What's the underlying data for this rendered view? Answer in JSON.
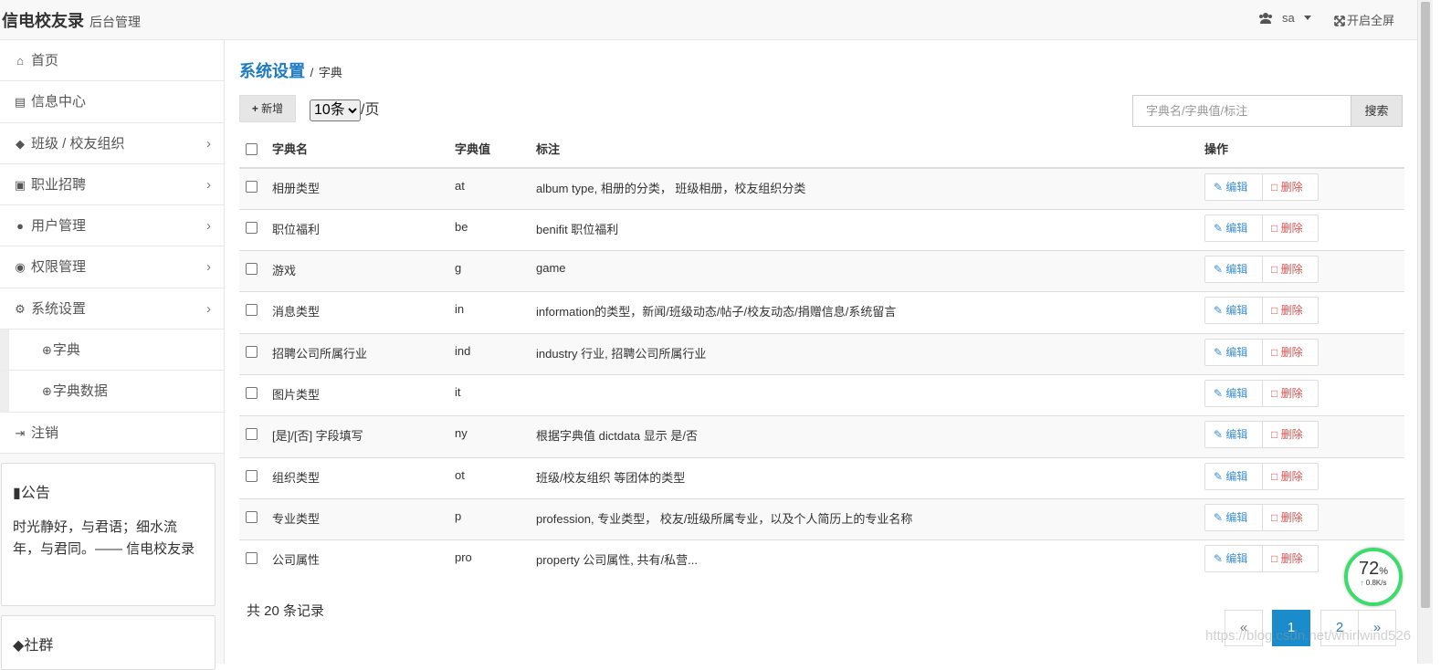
{
  "header": {
    "brand": "信电校友录",
    "brand_sub": "后台管理",
    "user_icon": "users-icon",
    "user_name": "sa",
    "fullscreen_icon": "expand-icon",
    "fullscreen_label": "开启全屏"
  },
  "sidebar": {
    "items": [
      {
        "label": "首页",
        "icon": "home-icon"
      },
      {
        "label": "信息中心",
        "icon": "newspaper-icon"
      },
      {
        "label": "班级 / 校友组织",
        "icon": "graduation-cap-icon"
      },
      {
        "label": "职业招聘",
        "icon": "briefcase-icon"
      },
      {
        "label": "用户管理",
        "icon": "users-icon"
      },
      {
        "label": "权限管理",
        "icon": "eye-icon"
      },
      {
        "label": "系统设置",
        "icon": "cogs-icon"
      }
    ],
    "subitems": [
      {
        "label": "字典",
        "icon": "search-plus-icon"
      },
      {
        "label": "字典数据",
        "icon": "search-plus-icon"
      }
    ],
    "logout": {
      "label": "注销",
      "icon": "sign-out-icon"
    },
    "notice": {
      "title": "公告",
      "icon": "bookmark-icon",
      "body": "时光静好，与君语；细水流年，与君同。—— 信电校友录"
    },
    "community": {
      "title": "社群",
      "icon": "tag-icon"
    }
  },
  "main": {
    "breadcrumb": {
      "section": "系统设置",
      "separator": " / ",
      "page": "字典"
    },
    "add_button": "新增",
    "per_page": {
      "selected": "10条",
      "suffix": "/页"
    },
    "search": {
      "placeholder": "字典名/字典值/标注",
      "button": "搜索"
    },
    "table": {
      "columns": [
        "字典名",
        "字典值",
        "标注",
        "操作"
      ],
      "rows": [
        {
          "name": "相册类型",
          "value": "at",
          "note": "album type, 相册的分类， 班级相册，校友组织分类"
        },
        {
          "name": "职位福利",
          "value": "be",
          "note": "benifit 职位福利"
        },
        {
          "name": "游戏",
          "value": "g",
          "note": "game"
        },
        {
          "name": "消息类型",
          "value": "in",
          "note": "information的类型，新闻/班级动态/帖子/校友动态/捐赠信息/系统留言"
        },
        {
          "name": "招聘公司所属行业",
          "value": "ind",
          "note": "industry 行业, 招聘公司所属行业"
        },
        {
          "name": "图片类型",
          "value": "it",
          "note": ""
        },
        {
          "name": "[是]/[否] 字段填写",
          "value": "ny",
          "note": "根据字典值 dictdata 显示 是/否"
        },
        {
          "name": "组织类型",
          "value": "ot",
          "note": "班级/校友组织 等团体的类型"
        },
        {
          "name": "专业类型",
          "value": "p",
          "note": "profession, 专业类型， 校友/班级所属专业，以及个人简历上的专业名称"
        },
        {
          "name": "公司属性",
          "value": "pro",
          "note": "property 公司属性, 共有/私营..."
        }
      ],
      "edit_label": "编辑",
      "delete_label": "删除"
    },
    "total": "共 20 条记录",
    "pagination": {
      "prev": "«",
      "pages": [
        "1",
        "2"
      ],
      "active": "1",
      "next": "»"
    }
  },
  "overlay": {
    "speed_percent": "72",
    "speed_unit": "%",
    "speed_rate": "0.8K/s",
    "watermark": "https://blog.csdn.net/whirlwind526"
  },
  "colors": {
    "accent": "#1e7bc4",
    "active_page": "#1a8ccc",
    "delete": "#d9534f",
    "edit": "#3a8fd6"
  }
}
